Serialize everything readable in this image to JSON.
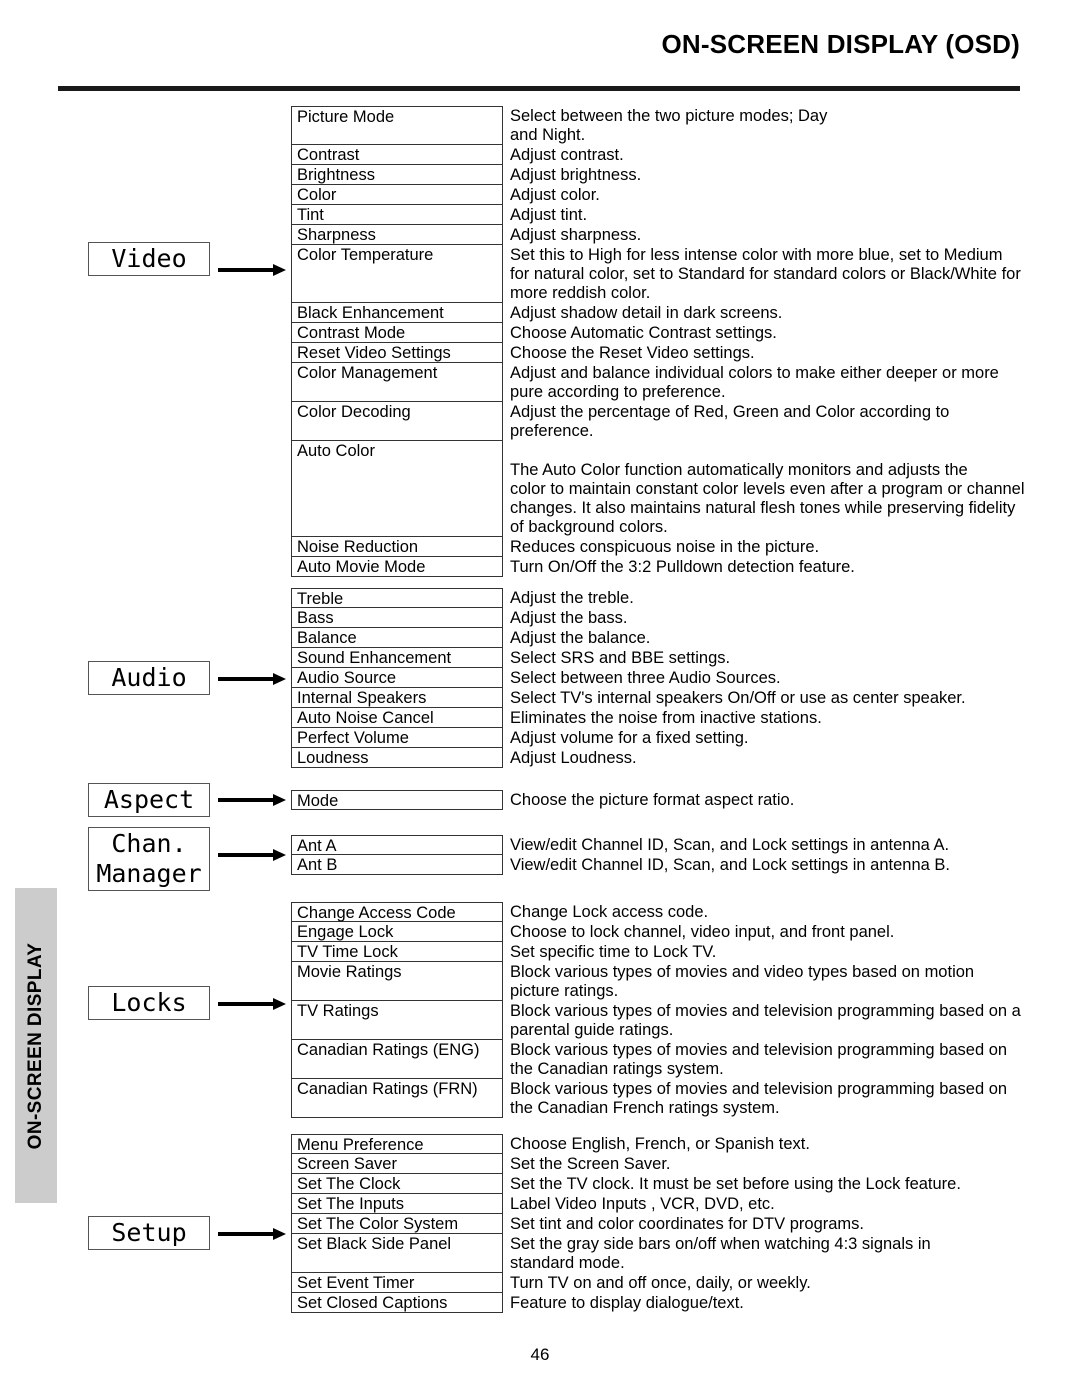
{
  "header": {
    "title": "ON-SCREEN DISPLAY (OSD)"
  },
  "side_tab": {
    "label": "ON-SCREEN DISPLAY"
  },
  "page_number": "46",
  "categories": {
    "video": {
      "lines": [
        "Video"
      ]
    },
    "audio": {
      "lines": [
        "Audio"
      ]
    },
    "aspect": {
      "lines": [
        "Aspect"
      ]
    },
    "chan_manager": {
      "lines": [
        "Chan.",
        "Manager"
      ]
    },
    "locks": {
      "lines": [
        "Locks"
      ]
    },
    "setup": {
      "lines": [
        "Setup"
      ]
    }
  },
  "groups": {
    "video": [
      {
        "name": "Picture Mode",
        "desc": [
          "Select between the two picture modes; Day",
          "and Night."
        ]
      },
      {
        "name": "Contrast",
        "desc": [
          "Adjust contrast."
        ]
      },
      {
        "name": "Brightness",
        "desc": [
          "Adjust brightness."
        ]
      },
      {
        "name": "Color",
        "desc": [
          "Adjust color."
        ]
      },
      {
        "name": "Tint",
        "desc": [
          "Adjust tint."
        ]
      },
      {
        "name": "Sharpness",
        "desc": [
          "Adjust sharpness."
        ]
      },
      {
        "name": "Color Temperature",
        "desc": [
          "Set this to High for less intense color with more blue, set to Medium",
          "for natural color, set to Standard for standard colors or Black/White for",
          "more reddish color."
        ]
      },
      {
        "name": "Black Enhancement",
        "desc": [
          "Adjust shadow detail in dark screens."
        ]
      },
      {
        "name": "Contrast Mode",
        "desc": [
          "Choose Automatic Contrast settings."
        ]
      },
      {
        "name": "Reset Video Settings",
        "desc": [
          "Choose the Reset Video settings."
        ]
      },
      {
        "name": "Color Management",
        "desc": [
          "Adjust and balance individual colors to make either deeper or more",
          "pure according to preference."
        ]
      },
      {
        "name": "Color Decoding",
        "desc": [
          "Adjust the percentage of Red, Green and Color according to",
          "preference."
        ]
      },
      {
        "name": "Auto Color",
        "desc": [
          "",
          "The Auto Color function automatically monitors and adjusts the",
          "color to maintain constant color levels even after a program or channel",
          "changes. It also maintains natural flesh tones while preserving fidelity",
          "of background colors."
        ]
      },
      {
        "name": "Noise Reduction",
        "desc": [
          "Reduces conspicuous noise in the picture."
        ]
      },
      {
        "name": "Auto Movie Mode",
        "desc": [
          "Turn On/Off the 3:2 Pulldown detection feature."
        ]
      }
    ],
    "audio": [
      {
        "name": "Treble",
        "desc": [
          "Adjust the treble."
        ]
      },
      {
        "name": "Bass",
        "desc": [
          "Adjust the bass."
        ]
      },
      {
        "name": "Balance",
        "desc": [
          "Adjust the balance."
        ]
      },
      {
        "name": "Sound Enhancement",
        "desc": [
          "Select SRS and BBE settings."
        ]
      },
      {
        "name": "Audio Source",
        "desc": [
          "Select between three Audio Sources."
        ]
      },
      {
        "name": "Internal Speakers",
        "desc": [
          "Select TV's internal speakers On/Off or use as center speaker."
        ]
      },
      {
        "name": "Auto Noise Cancel",
        "desc": [
          "Eliminates the noise from inactive stations."
        ]
      },
      {
        "name": "Perfect Volume",
        "desc": [
          "Adjust volume for a fixed setting."
        ]
      },
      {
        "name": "Loudness",
        "desc": [
          "Adjust Loudness."
        ]
      }
    ],
    "aspect": [
      {
        "name": "Mode",
        "desc": [
          "Choose the picture format aspect ratio."
        ]
      }
    ],
    "chan_manager": [
      {
        "name": "Ant A",
        "desc": [
          "View/edit Channel ID, Scan, and Lock settings in antenna A."
        ]
      },
      {
        "name": "Ant B",
        "desc": [
          "View/edit Channel ID, Scan, and Lock settings in antenna B."
        ]
      }
    ],
    "locks": [
      {
        "name": "Change Access Code",
        "desc": [
          "Change Lock access code."
        ]
      },
      {
        "name": "Engage Lock",
        "desc": [
          "Choose to lock channel, video input, and front panel."
        ]
      },
      {
        "name": "TV Time Lock",
        "desc": [
          "Set specific time to Lock TV."
        ]
      },
      {
        "name": "Movie Ratings",
        "desc": [
          "Block various types of movies and video types based on motion",
          "picture ratings."
        ]
      },
      {
        "name": "TV Ratings",
        "desc": [
          "Block various types of movies and television programming based on a",
          "parental guide ratings."
        ]
      },
      {
        "name": "Canadian Ratings (ENG)",
        "desc": [
          "Block various types of movies and television programming based on",
          "the Canadian ratings system."
        ]
      },
      {
        "name": "Canadian Ratings (FRN)",
        "desc": [
          "Block various types of movies and television programming based on",
          "the Canadian French ratings system."
        ]
      }
    ],
    "setup": [
      {
        "name": "Menu Preference",
        "desc": [
          "Choose English, French, or Spanish text."
        ]
      },
      {
        "name": "Screen Saver",
        "desc": [
          "Set the Screen Saver."
        ]
      },
      {
        "name": "Set The Clock",
        "desc": [
          "Set the TV clock.  It must be set before using the Lock feature."
        ]
      },
      {
        "name": "Set The Inputs",
        "desc": [
          "Label Video Inputs , VCR, DVD, etc."
        ]
      },
      {
        "name": "Set The Color System",
        "desc": [
          "Set tint and color coordinates for DTV programs."
        ]
      },
      {
        "name": "Set Black Side Panel",
        "desc": [
          "Set the gray side bars on/off when watching 4:3 signals in",
          "standard mode."
        ]
      },
      {
        "name": "Set Event Timer",
        "desc": [
          "Turn TV on and off once, daily, or weekly."
        ]
      },
      {
        "name": "Set Closed Captions",
        "desc": [
          "Feature to display dialogue/text."
        ]
      }
    ]
  }
}
